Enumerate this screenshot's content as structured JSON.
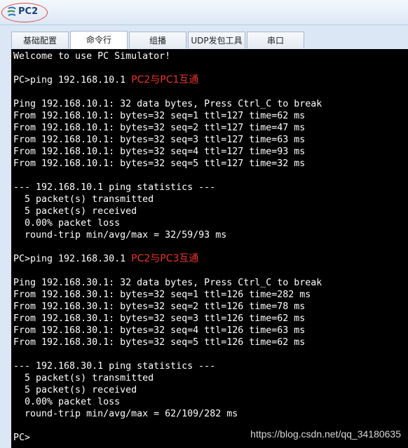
{
  "window": {
    "title": "PC2"
  },
  "tabs": [
    {
      "label": "基础配置"
    },
    {
      "label": "命令行"
    },
    {
      "label": "组播"
    },
    {
      "label": "UDP发包工具"
    },
    {
      "label": "串口"
    }
  ],
  "active_tab": "命令行",
  "console": {
    "welcome": "Welcome to use PC Simulator!",
    "ping1": {
      "command": "PC>ping 192.168.10.1",
      "annotation": "PC2与PC1互通",
      "header": "Ping 192.168.10.1: 32 data bytes, Press Ctrl_C to break",
      "replies": [
        "From 192.168.10.1: bytes=32 seq=1 ttl=127 time=62 ms",
        "From 192.168.10.1: bytes=32 seq=2 ttl=127 time=47 ms",
        "From 192.168.10.1: bytes=32 seq=3 ttl=127 time=63 ms",
        "From 192.168.10.1: bytes=32 seq=4 ttl=127 time=93 ms",
        "From 192.168.10.1: bytes=32 seq=5 ttl=127 time=32 ms"
      ],
      "stats_title": "--- 192.168.10.1 ping statistics ---",
      "stats": [
        "  5 packet(s) transmitted",
        "  5 packet(s) received",
        "  0.00% packet loss",
        "  round-trip min/avg/max = 32/59/93 ms"
      ]
    },
    "ping2": {
      "command": "PC>ping 192.168.30.1",
      "annotation": "PC2与PC3互通",
      "header": "Ping 192.168.30.1: 32 data bytes, Press Ctrl_C to break",
      "replies": [
        "From 192.168.30.1: bytes=32 seq=1 ttl=126 time=282 ms",
        "From 192.168.30.1: bytes=32 seq=2 ttl=126 time=78 ms",
        "From 192.168.30.1: bytes=32 seq=3 ttl=126 time=62 ms",
        "From 192.168.30.1: bytes=32 seq=4 ttl=126 time=63 ms",
        "From 192.168.30.1: bytes=32 seq=5 ttl=126 time=62 ms"
      ],
      "stats_title": "--- 192.168.30.1 ping statistics ---",
      "stats": [
        "  5 packet(s) transmitted",
        "  5 packet(s) received",
        "  0.00% packet loss",
        "  round-trip min/avg/max = 62/109/282 ms"
      ]
    },
    "prompt": "PC>"
  },
  "watermark": "https://blog.csdn.net/qq_34180635",
  "colors": {
    "console_bg": "#000000",
    "console_text": "#ffffff",
    "annotation": "#e8362b",
    "highlight_circle": "#e0463a"
  }
}
